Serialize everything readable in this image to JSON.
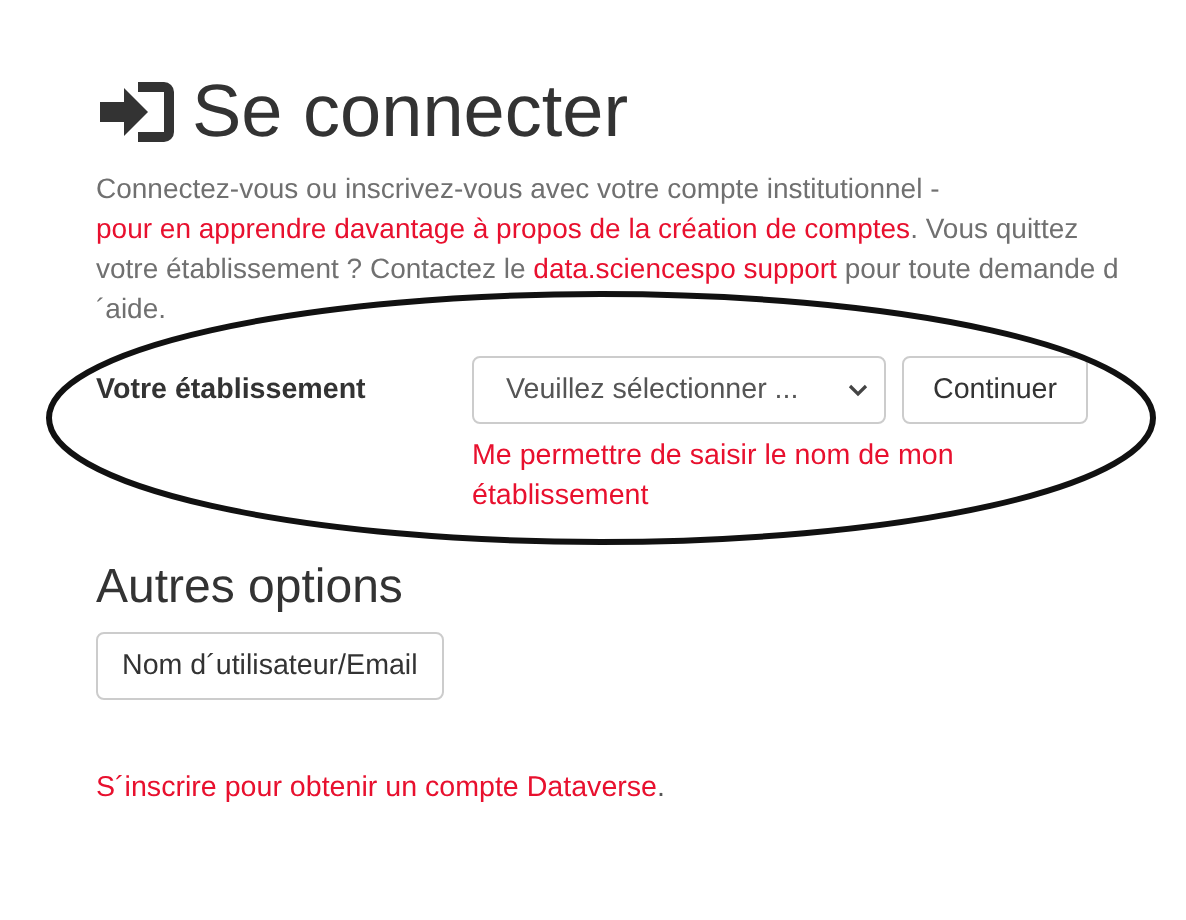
{
  "title": "Se connecter",
  "intro": [
    {
      "kind": "text",
      "text": "Connectez-vous ou inscrivez-vous avec votre compte institutionnel - "
    },
    {
      "kind": "link",
      "text": "pour en apprendre davantage à propos de la création de comptes"
    },
    {
      "kind": "text",
      "text": ". Vous quittez votre établissement ? Contactez le "
    },
    {
      "kind": "link",
      "text": "data.sciencespo support"
    },
    {
      "kind": "text",
      "text": " pour toute demande d´aide."
    }
  ],
  "institution": {
    "label": "Votre établissement",
    "select": "Veuillez sélectionner ...",
    "button": "Continuer",
    "manual_link": "Me permettre de saisir le nom de mon établissement"
  },
  "other_options": {
    "title": "Autres options",
    "button": "Nom d´utilisateur/Email"
  },
  "signup": {
    "link": "S´inscrire pour obtenir un compte Dataverse",
    "tail": "."
  }
}
